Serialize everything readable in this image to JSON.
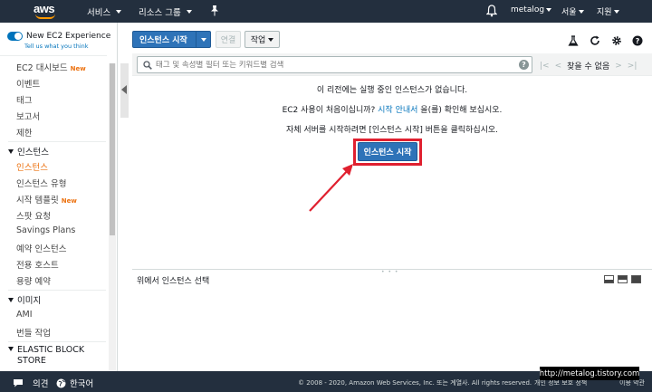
{
  "header": {
    "logo_text": "aws",
    "services_label": "서비스",
    "resource_groups_label": "리소스 그룹",
    "pin_icon": "pin-icon",
    "bell_icon": "bell-icon",
    "account_label": "metalog",
    "region_label": "서울",
    "support_label": "지원",
    "colors": {
      "nav_bg": "#232f3e",
      "logo_smile": "#ff9900"
    }
  },
  "sidebar": {
    "experience_label": "New EC2 Experience",
    "experience_link": "Tell us what you think",
    "items": [
      {
        "label": "EC2 대시보드",
        "badge": "New"
      },
      {
        "label": "이벤트"
      },
      {
        "label": "태그"
      },
      {
        "label": "보고서"
      },
      {
        "label": "제한"
      }
    ],
    "section_instances": {
      "title": "인스턴스",
      "items": [
        {
          "label": "인스턴스",
          "active": true
        },
        {
          "label": "인스턴스 유형"
        },
        {
          "label": "시작 템플릿",
          "badge": "New"
        },
        {
          "label": "스팟 요청"
        },
        {
          "label": "Savings Plans"
        },
        {
          "label": "예약 인스턴스"
        },
        {
          "label": "전용 호스트"
        },
        {
          "label": "용량 예약"
        }
      ]
    },
    "section_images": {
      "title": "이미지",
      "items": [
        {
          "label": "AMI"
        },
        {
          "label": "번들 작업"
        }
      ]
    },
    "section_ebs": {
      "title_line1": "ELASTIC BLOCK",
      "title_line2": "STORE"
    },
    "colors": {
      "active": "#ec7211",
      "toggle": "#0073bb"
    }
  },
  "toolbar": {
    "launch_label": "인스턴스 시작",
    "connect_label": "연결",
    "actions_label": "작업"
  },
  "search": {
    "placeholder": "태그 및 속성별 필터 또는 키워드별 검색",
    "count_label": "찾을 수 없음"
  },
  "empty_state": {
    "line1": "이 리전에는 실행 중인 인스턴스가 없습니다.",
    "line2_before": "EC2 사용이 처음이십니까? ",
    "line2_link": "시작 안내서",
    "line2_after": " 을(를) 확인해 보십시오.",
    "line3": "자체 서버를 시작하려면 [인스턴스 시작] 버튼을 클릭하십시오.",
    "launch_label": "인스턴스 시작",
    "colors": {
      "highlight": "#e0202f",
      "primary": "#2e73b8"
    }
  },
  "bottom_pane": {
    "title": "위에서 인스턴스 선택"
  },
  "footer": {
    "feedback_label": "의견",
    "language_label": "한국어",
    "copyright": "© 2008 - 2020, Amazon Web Services, Inc. 또는 계열사. All rights reserved.",
    "privacy_label": "개인 정보 보호 정책",
    "terms_label": "이용 약관"
  },
  "watermark": "http://metalog.tistory.com"
}
